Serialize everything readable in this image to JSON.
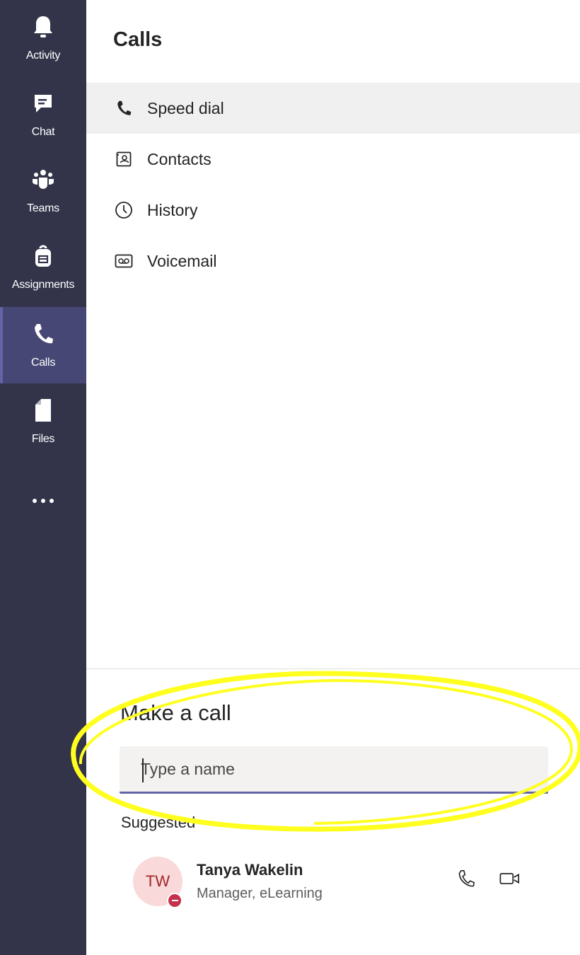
{
  "rail": {
    "items": [
      {
        "label": "Activity",
        "icon": "bell-icon"
      },
      {
        "label": "Chat",
        "icon": "chat-icon"
      },
      {
        "label": "Teams",
        "icon": "teams-icon"
      },
      {
        "label": "Assignments",
        "icon": "backpack-icon"
      },
      {
        "label": "Calls",
        "icon": "phone-icon",
        "active": true
      },
      {
        "label": "Files",
        "icon": "file-icon"
      }
    ],
    "more": "more-icon"
  },
  "page": {
    "title": "Calls",
    "nav": [
      {
        "label": "Speed dial",
        "icon": "phone-icon",
        "selected": true
      },
      {
        "label": "Contacts",
        "icon": "contact-card-icon"
      },
      {
        "label": "History",
        "icon": "clock-icon"
      },
      {
        "label": "Voicemail",
        "icon": "voicemail-icon"
      }
    ]
  },
  "make_call": {
    "title": "Make a call",
    "placeholder": "Type a name",
    "suggested_label": "Suggested",
    "contacts": [
      {
        "initials": "TW",
        "name": "Tanya Wakelin",
        "subtitle": "Manager, eLearning",
        "presence": "do-not-disturb"
      }
    ]
  },
  "colors": {
    "rail_bg": "#33344a",
    "rail_active": "#464775",
    "accent": "#6264a7",
    "annotation": "#ffff1f",
    "presence_dnd": "#c4314b"
  }
}
